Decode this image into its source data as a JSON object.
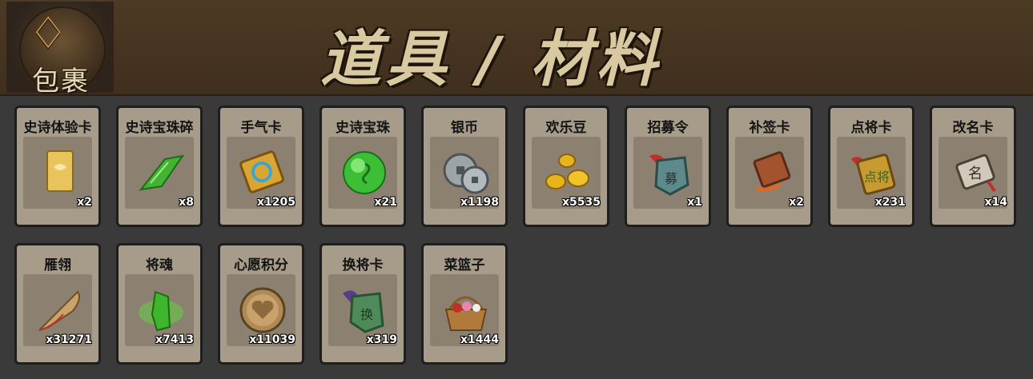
{
  "header": {
    "bag_label": "包裹",
    "bag_glyph": "♢",
    "title": "道具 / 材料"
  },
  "items": [
    {
      "name": "史诗体验卡",
      "count": "x2",
      "icon": "gold-card-icon"
    },
    {
      "name": "史诗宝珠碎",
      "count": "x8",
      "icon": "green-shard-icon"
    },
    {
      "name": "手气卡",
      "count": "x1205",
      "icon": "luck-card-icon"
    },
    {
      "name": "史诗宝珠",
      "count": "x21",
      "icon": "green-orb-icon"
    },
    {
      "name": "银币",
      "count": "x1198",
      "icon": "silver-coins-icon"
    },
    {
      "name": "欢乐豆",
      "count": "x5535",
      "icon": "gold-beans-icon"
    },
    {
      "name": "招募令",
      "count": "x1",
      "icon": "recruit-token-icon"
    },
    {
      "name": "补签卡",
      "count": "x2",
      "icon": "resign-card-icon"
    },
    {
      "name": "点将卡",
      "count": "x231",
      "icon": "general-card-icon"
    },
    {
      "name": "改名卡",
      "count": "x14",
      "icon": "rename-card-icon"
    },
    {
      "name": "雁翎",
      "count": "x31271",
      "icon": "feather-icon"
    },
    {
      "name": "将魂",
      "count": "x7413",
      "icon": "soul-crystal-icon"
    },
    {
      "name": "心愿积分",
      "count": "x11039",
      "icon": "heart-coin-icon"
    },
    {
      "name": "换将卡",
      "count": "x319",
      "icon": "swap-card-icon"
    },
    {
      "name": "菜篮子",
      "count": "x1444",
      "icon": "basket-icon"
    }
  ]
}
